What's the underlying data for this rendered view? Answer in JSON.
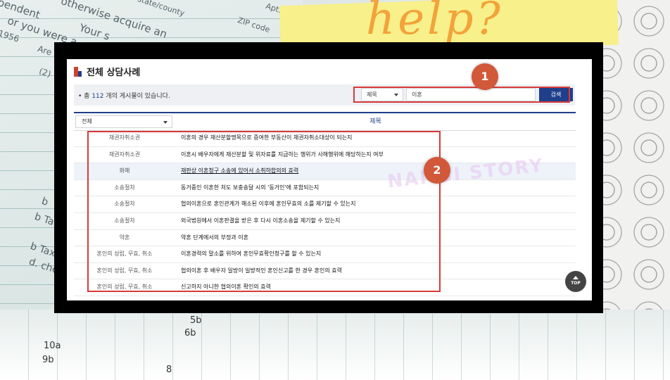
{
  "background": {
    "paper_lines": [
      "pendent",
      "otherwise acquire an",
      "state/county",
      "Apt.",
      "or you were a",
      "Your s",
      "ZIP code",
      "1956",
      "Are",
      "(2)"
    ],
    "paper_side_letters": [
      "b",
      "b Ta",
      "b Taxa",
      "d. check"
    ],
    "bottom_labels": [
      "5b",
      "6b",
      "10a",
      "9b",
      "8"
    ],
    "sticky_note_text": "help?"
  },
  "page": {
    "title": "전체 상담사례",
    "count_prefix": "• 총 ",
    "count_number": "112",
    "count_suffix": " 개의 게시물이 있습니다."
  },
  "search": {
    "field_select": "제목",
    "query": "이혼",
    "button_label": "검색"
  },
  "table": {
    "category_filter": "전체",
    "title_header": "제목",
    "rows": [
      {
        "category": "채권자취소권",
        "title": "이혼의 경우 재산분할명목으로 증여한 부동산이 채권자취소대상이 되는지"
      },
      {
        "category": "채권자취소권",
        "title": "이혼시 배우자에게 재산분할 및 위자료를 지급하는 행위가 사해행위에 해당하는지 여부"
      },
      {
        "category": "화해",
        "title": "재판상 이혼청구 소송에 있어서 소취하합의의 효력"
      },
      {
        "category": "소송절차",
        "title": "동거중인 이혼한 처도 보충송달 시의 '동거인'에 포함되는지"
      },
      {
        "category": "소송절차",
        "title": "협의이혼으로 혼인관계가 해소된 이후에 혼인무효의 소를 제기할 수 있는지"
      },
      {
        "category": "소송절차",
        "title": "외국법원에서 이혼판결을 받은 후 다시 이혼소송을 제기할 수 있는지"
      },
      {
        "category": "약혼",
        "title": "약혼 단계에서의 부정과 이혼"
      },
      {
        "category": "혼인의 성립, 무효, 취소",
        "title": "이혼경력의 말소를 위하여 혼인무효확인청구를 할 수 있는지"
      },
      {
        "category": "혼인의 성립, 무효, 취소",
        "title": "협의이혼 후 배우자 일방이 일방적인 혼인신고를 한 경우 혼인의 효력"
      },
      {
        "category": "혼인의 성립, 무효, 취소",
        "title": "신고하지 아니한 협의이혼 확인의 효력"
      }
    ]
  },
  "top_button": {
    "label": "TOP"
  },
  "watermark": "NAMSI STORY",
  "annotations": {
    "badge1": "1",
    "badge2": "2"
  },
  "colors": {
    "accent": "#1f3f8a",
    "annotation_red": "#d93a3a",
    "badge": "#d2583a"
  }
}
